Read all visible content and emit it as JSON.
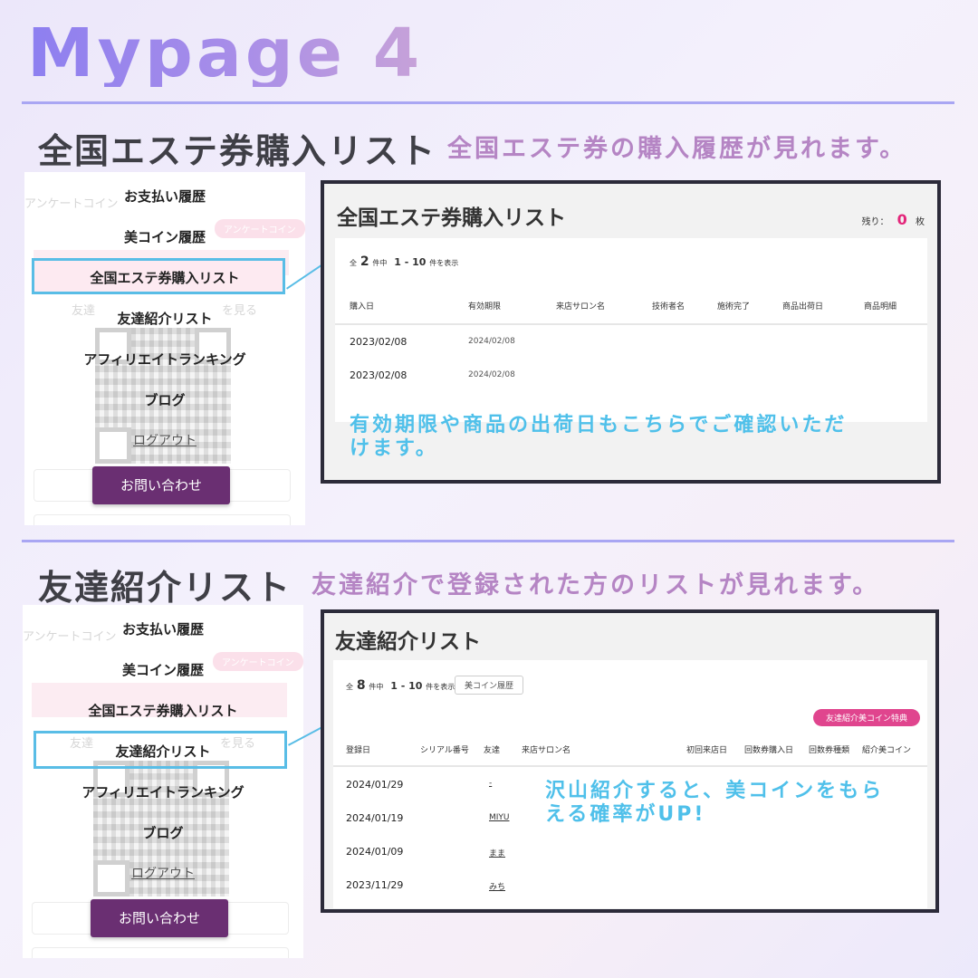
{
  "header": {
    "title": "Mypage 4"
  },
  "menu": {
    "ghost_text_1": "アンケートコイン",
    "ghost_pill": "アンケートコイン",
    "ghost_text_2": "友達",
    "ghost_text_3": "を見る",
    "items": [
      "お支払い履歴",
      "美コイン履歴",
      "全国エステ券購入リスト",
      "友達紹介リスト",
      "アフィリエイトランキング",
      "ブログ"
    ],
    "logout": "ログアウト",
    "contact": "お問い合わせ"
  },
  "section1": {
    "title": "全国エステ券購入リスト",
    "desc": "全国エステ券の購入履歴が見れます。",
    "panel": {
      "title": "全国エステ券購入リスト",
      "remain_label": "残り：",
      "remain_value": "0",
      "remain_unit": "枚",
      "count_prefix": "全",
      "count_total": "2",
      "count_mid": "件中",
      "count_range": "1 - 10",
      "count_suffix": "件を表示",
      "columns": [
        "購入日",
        "有効期限",
        "来店サロン名",
        "技術者名",
        "施術完了",
        "商品出荷日",
        "商品明細"
      ],
      "rows": [
        {
          "date": "2023/02/08",
          "expiry": "2024/02/08"
        },
        {
          "date": "2023/02/08",
          "expiry": "2024/02/08"
        }
      ],
      "note": [
        "有効期限や商品の出荷日もこちらでご確認いただ",
        "けます。"
      ]
    }
  },
  "section2": {
    "title": "友達紹介リスト",
    "desc": "友達紹介で登録された方のリストが見れます。",
    "panel": {
      "title": "友達紹介リスト",
      "count_prefix": "全",
      "count_total": "8",
      "count_mid": "件中",
      "count_range": "1 - 10",
      "count_suffix": "件を表示",
      "coin_history_button": "美コイン履歴",
      "badge": "友達紹介美コイン特典",
      "columns": [
        "登録日",
        "シリアル番号",
        "友達",
        "来店サロン名",
        "初回来店日",
        "回数券購入日",
        "回数券種類",
        "紹介美コイン"
      ],
      "rows": [
        {
          "date": "2024/01/29",
          "friend": "-"
        },
        {
          "date": "2024/01/19",
          "friend": "MIYU"
        },
        {
          "date": "2024/01/09",
          "friend": "まま"
        },
        {
          "date": "2023/11/29",
          "friend": "みち"
        }
      ],
      "note": [
        "沢山紹介すると、美コインをもら",
        "える確率がUP!"
      ]
    }
  },
  "colors": {
    "accent_purple": "#6a2f72",
    "highlight_blue": "#59bde6",
    "note_blue": "#4fc0ea",
    "pink_badge": "#e0458e",
    "remain_pink": "#e3267a"
  }
}
